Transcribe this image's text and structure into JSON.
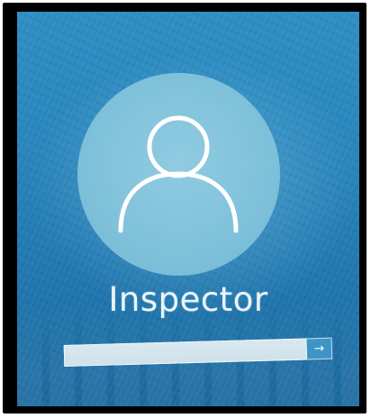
{
  "login": {
    "username": "Inspector",
    "password": {
      "value": "",
      "placeholder": ""
    },
    "submit_icon": "→"
  },
  "icons": {
    "avatar": "user-silhouette-icon",
    "submit": "arrow-right-icon"
  },
  "colors": {
    "background": "#2a86bd",
    "avatar_circle": "#7fc1da",
    "avatar_glyph": "#ffffff",
    "submit_button": "#3d95c6"
  }
}
